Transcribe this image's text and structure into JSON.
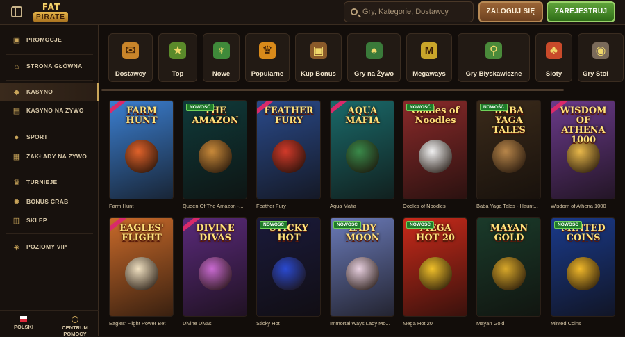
{
  "header": {
    "logo_top": "FAT",
    "logo_bottom": "PIRATE",
    "search_placeholder": "Gry, Kategorie, Dostawcy",
    "login_label": "ZALOGUJ SIĘ",
    "register_label": "ZAREJESTRUJ"
  },
  "sidebar": {
    "items": [
      {
        "label": "PROMOCJE",
        "icon": "promo-icon"
      },
      {
        "label": "STRONA GŁÓWNA",
        "icon": "home-icon"
      },
      {
        "label": "KASYNO",
        "icon": "casino-icon",
        "active": true
      },
      {
        "label": "KASYNO NA ŻYWO",
        "icon": "live-casino-icon"
      },
      {
        "label": "SPORT",
        "icon": "sport-icon"
      },
      {
        "label": "ZAKŁADY NA ŻYWO",
        "icon": "live-bets-icon"
      },
      {
        "label": "TURNIEJE",
        "icon": "trophy-icon"
      },
      {
        "label": "BONUS CRAB",
        "icon": "crab-icon"
      },
      {
        "label": "SKLEP",
        "icon": "shop-icon"
      },
      {
        "label": "POZIOMY VIP",
        "icon": "vip-icon"
      }
    ],
    "footer": {
      "language": "POLSKI",
      "help_line1": "CENTRUM",
      "help_line2": "POMOCY"
    }
  },
  "categories": [
    {
      "label": "Dostawcy",
      "icon": "scroll-icon",
      "color": "#c9852a"
    },
    {
      "label": "Top",
      "icon": "star-icon",
      "color": "#5a8a2a"
    },
    {
      "label": "Nowe",
      "icon": "chalice-icon",
      "color": "#3f8a3a"
    },
    {
      "label": "Popularne",
      "icon": "crown-icon",
      "color": "#d98a1a"
    },
    {
      "label": "Kup Bonus",
      "icon": "chest-icon",
      "color": "#8a5a2a"
    },
    {
      "label": "Gry na Żywo",
      "icon": "card-icon",
      "color": "#3a7a3a"
    },
    {
      "label": "Megaways",
      "icon": "m-icon",
      "color": "#c9a52a"
    },
    {
      "label": "Gry Błyskawiczne",
      "icon": "joystick-icon",
      "color": "#4a8a3a"
    },
    {
      "label": "Sloty",
      "icon": "cherry-icon",
      "color": "#c94a2a"
    },
    {
      "label": "Gry Stoł",
      "icon": "table-icon",
      "color": "#7a6a5a"
    }
  ],
  "games": [
    {
      "name": "Farm Hunt",
      "title": "FARM HUNT",
      "badge": "",
      "ribbon": true,
      "bg": "#3b7fd1",
      "accent": "#e0622a"
    },
    {
      "name": "Queen Of The Amazon -...",
      "title": "THE AMAZON",
      "badge": "NOWOŚĆ",
      "ribbon": false,
      "bg": "#0f3a3a",
      "accent": "#c98a3a"
    },
    {
      "name": "Feather Fury",
      "title": "FEATHER FURY",
      "badge": "",
      "ribbon": true,
      "bg": "#2a4a8a",
      "accent": "#d23a2a"
    },
    {
      "name": "Aqua Mafia",
      "title": "AQUA MAFIA",
      "badge": "",
      "ribbon": true,
      "bg": "#1a6a6a",
      "accent": "#3a8a4a"
    },
    {
      "name": "Oodles of Noodles",
      "title": "Oodles of Noodles",
      "badge": "NOWOŚĆ",
      "ribbon": false,
      "bg": "#8a2a2a",
      "accent": "#f0f0f0"
    },
    {
      "name": "Baba Yaga Tales - Haunt...",
      "title": "BABA YAGA TALES",
      "badge": "NOWOŚĆ",
      "ribbon": false,
      "bg": "#3a2a1a",
      "accent": "#b8864a"
    },
    {
      "name": "Wisdom of Athena 1000",
      "title": "WISDOM OF ATHENA 1000",
      "badge": "",
      "ribbon": true,
      "bg": "#6a3a8a",
      "accent": "#e8b84a"
    },
    {
      "name": "Eagles' Flight Power Bet",
      "title": "EAGLES' FLIGHT",
      "badge": "",
      "ribbon": true,
      "bg": "#c96a2a",
      "accent": "#f0e0c0"
    },
    {
      "name": "Divine Divas",
      "title": "DIVINE DIVAS",
      "badge": "",
      "ribbon": true,
      "bg": "#5a2a7a",
      "accent": "#c96ad2"
    },
    {
      "name": "Sticky Hot",
      "title": "STICKY HOT",
      "badge": "NOWOŚĆ",
      "ribbon": false,
      "bg": "#1a1a3a",
      "accent": "#2a4ad2"
    },
    {
      "name": "Immortal Ways Lady Mo...",
      "title": "LADY MOON",
      "badge": "NOWOŚĆ",
      "ribbon": false,
      "bg": "#6a7ab8",
      "accent": "#e8d0e0"
    },
    {
      "name": "Mega Hot 20",
      "title": "MEGA HOT 20",
      "badge": "NOWOŚĆ",
      "ribbon": false,
      "bg": "#c92a1a",
      "accent": "#f0c02a"
    },
    {
      "name": "Mayan Gold",
      "title": "MAYAN GOLD",
      "badge": "",
      "ribbon": false,
      "bg": "#1a3a2a",
      "accent": "#d8a82a"
    },
    {
      "name": "Minted Coins",
      "title": "MINTED COINS",
      "badge": "NOWOŚĆ",
      "ribbon": false,
      "bg": "#1a3a8a",
      "accent": "#f0b82a"
    }
  ]
}
